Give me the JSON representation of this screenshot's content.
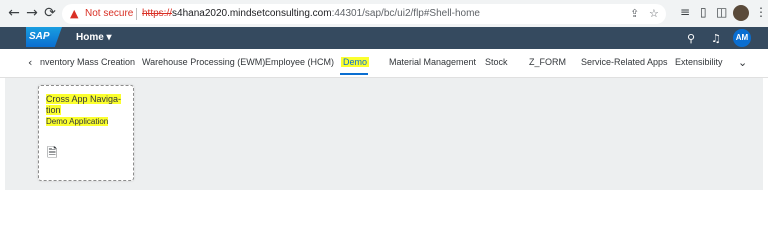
{
  "browser": {
    "back_icon": "←",
    "forward_icon": "→",
    "reload_icon": "C",
    "security_label": "Not secure",
    "url_scheme": "https://",
    "url_host": "s4hana2020.mindsetconsulting.com",
    "url_path": ":44301/sap/bc/ui2/flp#Shell-home",
    "icons": [
      "share-icon",
      "star-icon",
      "reading-list-icon",
      "sidebar-icon",
      "profile-icon",
      "menu-icon"
    ]
  },
  "shell": {
    "logo_text": "SAP",
    "home_label": "Home ▾",
    "avatar_initials": "AM",
    "icons": [
      "search-icon",
      "bell-icon"
    ]
  },
  "tabs": {
    "items": [
      "nventory Mass Creation",
      "Warehouse Processing (EWM)",
      "Employee (HCM)",
      "Demo",
      "Material Management",
      "Stock",
      "Z_FORM",
      "Service-Related Apps",
      "Extensibility"
    ],
    "active": "Demo",
    "left_arrow": "‹",
    "overflow_icon": "⌄"
  },
  "tile": {
    "title": "Cross App Naviga- tion",
    "subtitle": "Demo Application",
    "icon": "document-add-icon"
  },
  "colors": {
    "shell_bar": "#354a5f",
    "highlight": "#fbff2e",
    "accent": "#0a6ed1",
    "content_bg": "#edeff0"
  }
}
